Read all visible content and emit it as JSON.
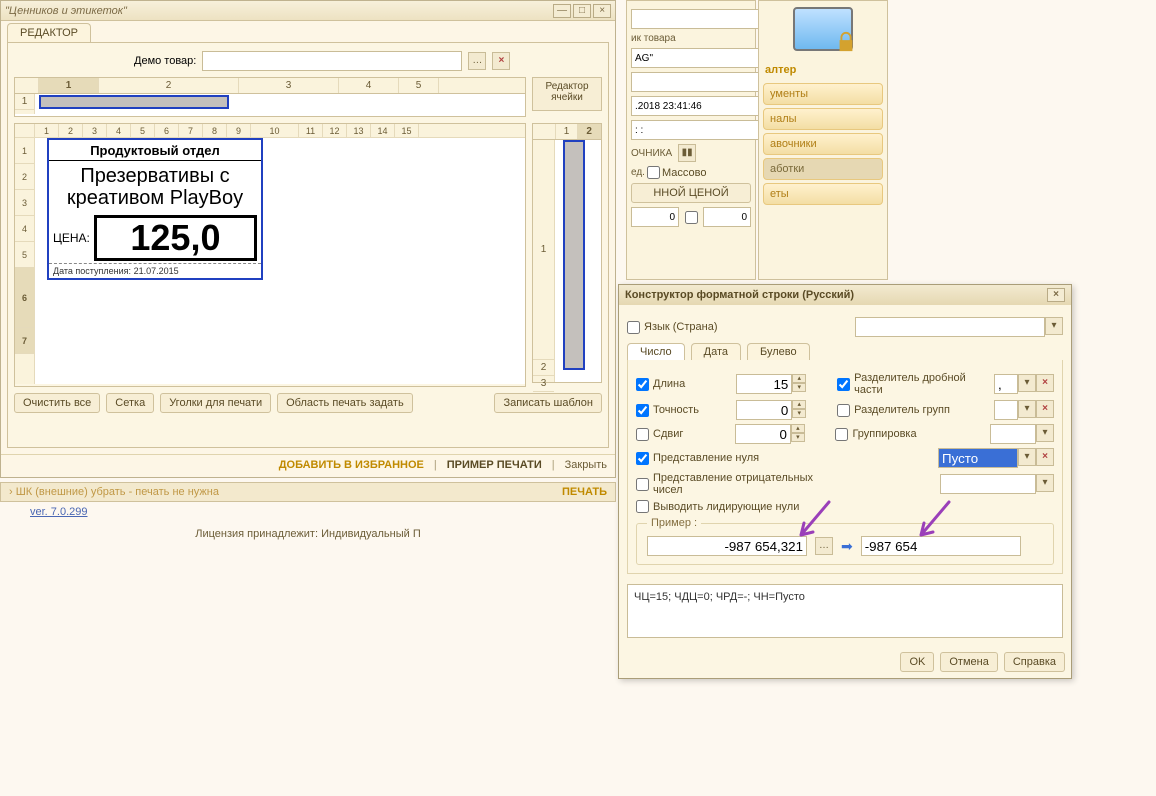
{
  "editor_window": {
    "title": "\"Ценников и этикеток\"",
    "tab": "РЕДАКТОР",
    "demo_label": "Демо товар:",
    "demo_value": "",
    "cell_editor_button": "Редактор ячейки",
    "top_sheet_cols": [
      "1",
      "2",
      "3",
      "4",
      "5"
    ],
    "ruler_cols": [
      "1",
      "2",
      "3",
      "4",
      "5",
      "6",
      "7",
      "8",
      "9",
      "10",
      "11",
      "12",
      "13",
      "14",
      "15"
    ],
    "ruler_rows": [
      "1",
      "2",
      "3",
      "4",
      "5",
      "6",
      "7"
    ],
    "mini_cols": [
      "1",
      "2"
    ],
    "mini_rows": [
      "1",
      "2",
      "3"
    ],
    "price_tag": {
      "department": "Продуктовый отдел",
      "product_name": "Презервативы с креативом PlayBoy",
      "price_label": "ЦЕНА:",
      "price_value": "125,0",
      "date_label": "Дата поступления:",
      "date_value": "21.07.2015"
    },
    "buttons": {
      "clear_all": "Очистить все",
      "grid": "Сетка",
      "print_corners": "Уголки для печати",
      "print_area": "Область печать задать",
      "save_template": "Записать шаблон"
    },
    "footer": {
      "add_fav": "ДОБАВИТЬ В ИЗБРАННОЕ",
      "print_sample": "ПРИМЕР ПЕЧАТИ",
      "close": "Закрыть"
    }
  },
  "print_bar": {
    "hint": "› ШК (внешние) убрать - печать не нужна",
    "print": "ПЕЧАТЬ"
  },
  "status": {
    "version_link": "ver. 7.0.299",
    "license": "Лицензия принадлежит: Индивидуальный П"
  },
  "bg_panel": {
    "rows": [
      {
        "text": "",
        "has_dots": true,
        "has_x": true
      },
      {
        "caption": "ик товара"
      },
      {
        "text": "AG\"",
        "has_dots": true,
        "has_x": true
      },
      {
        "text": "",
        "has_dots": true,
        "has_x": true
      },
      {
        "text": ".2018 23:41:46",
        "has_cal": true
      },
      {
        "text": ": :",
        "has_cal": true
      }
    ],
    "heading": "ОЧНИКА",
    "mass_before": "ед.",
    "mass": "Массово",
    "row2": "ННОЙ ЦЕНОЙ",
    "zero_left": "0",
    "zero_right": "0"
  },
  "nav_panel": {
    "heading": "алтер",
    "items": [
      "ументы",
      "налы",
      "авочники",
      "аботки",
      "еты"
    ]
  },
  "format_dialog": {
    "title": "Конструктор форматной строки (Русский)",
    "lang_label": "Язык (Страна)",
    "tabs": [
      "Число",
      "Дата",
      "Булево"
    ],
    "length_label": "Длина",
    "length_value": "15",
    "precision_label": "Точность",
    "precision_value": "0",
    "shift_label": "Сдвиг",
    "shift_value": "0",
    "fraction_sep_label": "Разделитель дробной части",
    "fraction_sep_value": ",",
    "group_sep_label": "Разделитель групп",
    "grouping_label": "Группировка",
    "zero_repr_label": "Представление нуля",
    "zero_repr_value": "Пусто",
    "neg_repr_label": "Представление отрицательных чисел",
    "leading_zeros_label": "Выводить лидирующие нули",
    "example_legend": "Пример :",
    "example_in": "-987 654,321",
    "example_out": "-987 654",
    "formula": "ЧЦ=15; ЧДЦ=0; ЧРД=-; ЧН=Пусто",
    "ok": "OK",
    "cancel": "Отмена",
    "help": "Справка"
  }
}
